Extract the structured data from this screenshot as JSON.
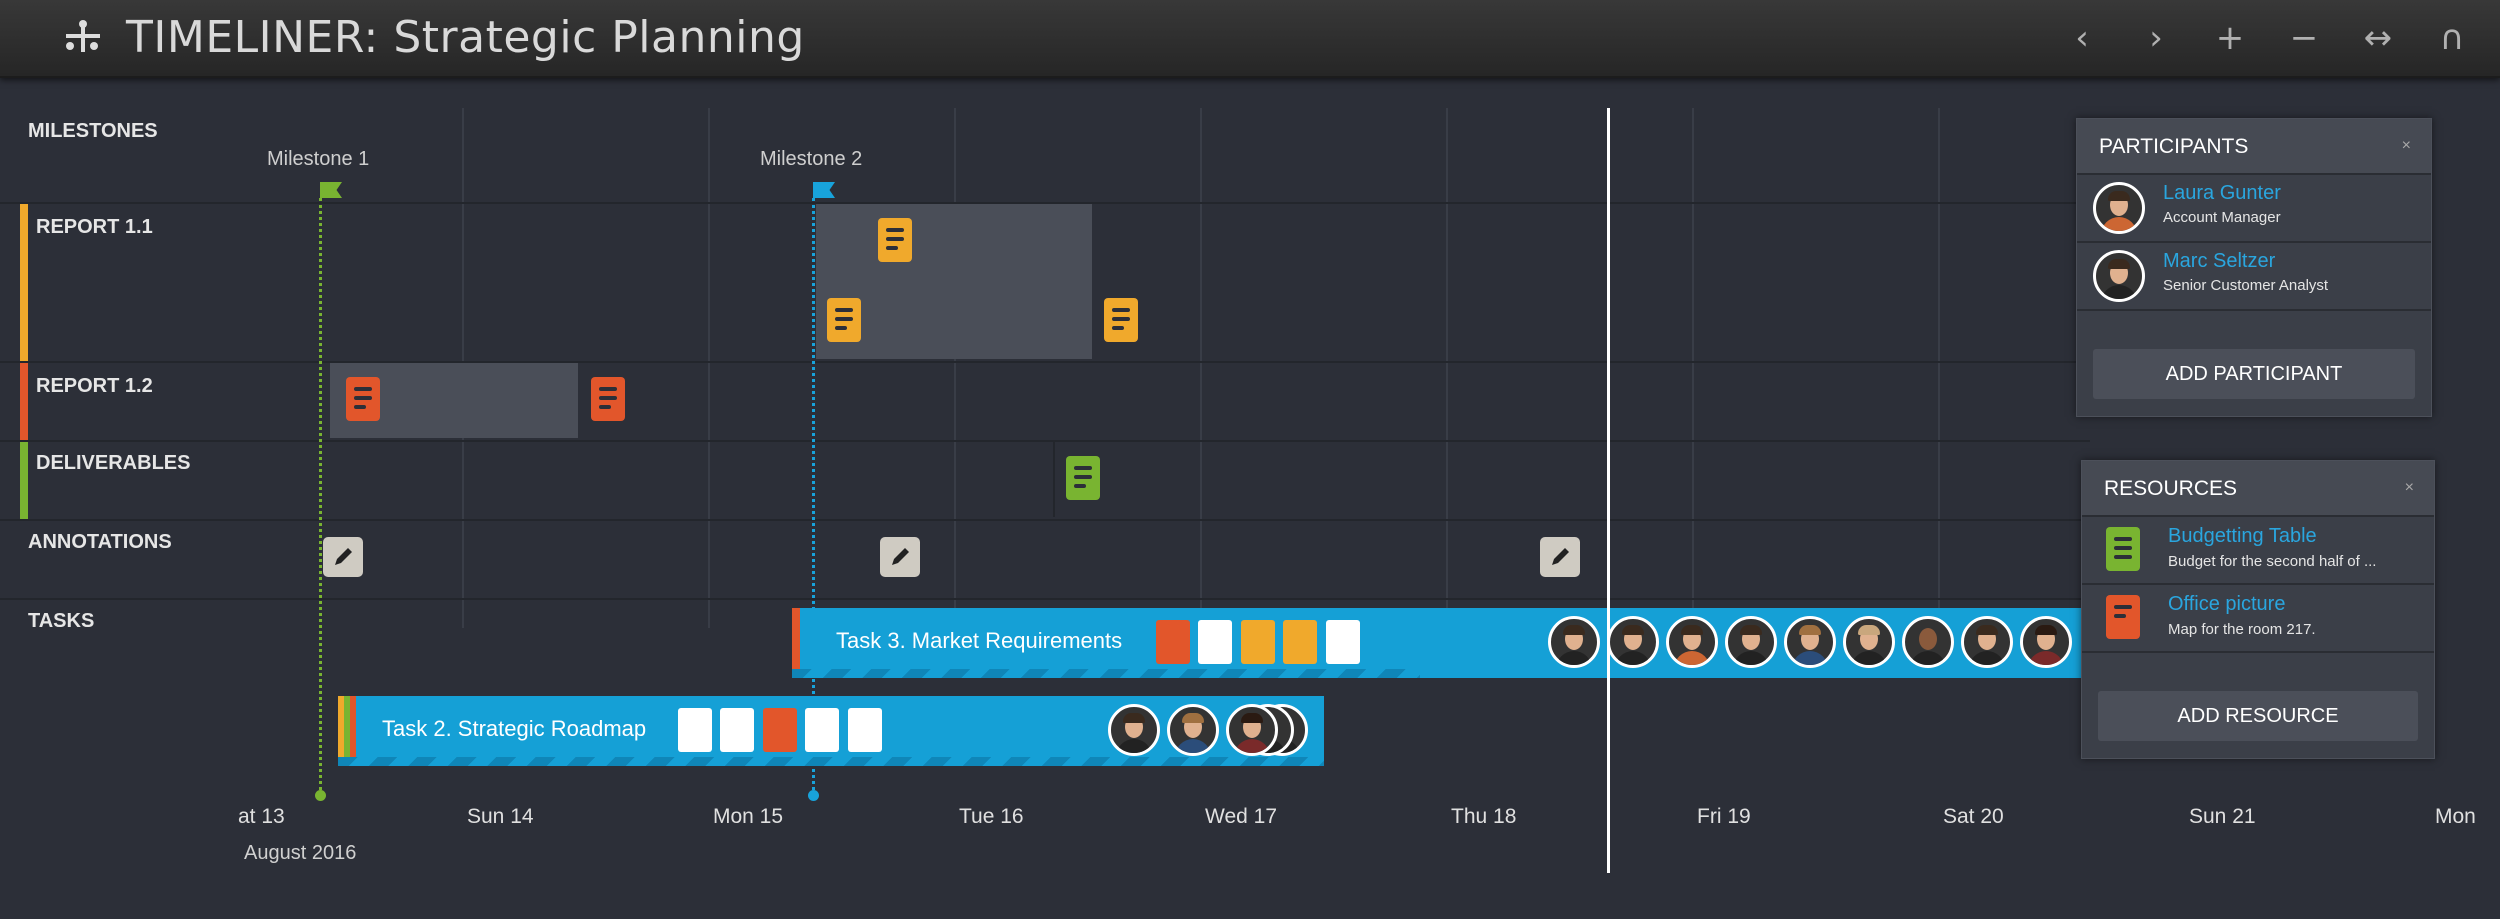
{
  "app": {
    "title": "TIMELINER: Strategic Planning"
  },
  "toolbar": {
    "prev": "‹",
    "next": "›",
    "zoom_in": "+",
    "zoom_out": "−",
    "fit": "↔",
    "magnet": "∩"
  },
  "rows": {
    "milestones": "MILESTONES",
    "report11": "REPORT 1.1",
    "report12": "REPORT 1.2",
    "deliverables": "DELIVERABLES",
    "annotations": "ANNOTATIONS",
    "tasks": "TASKS"
  },
  "row_colors": {
    "report11": "#f0a92c",
    "report12": "#e2562b",
    "deliverables": "#79b431"
  },
  "milestones": [
    {
      "label": "Milestone 1",
      "color": "#79b431"
    },
    {
      "label": "Milestone 2",
      "color": "#18a3db"
    }
  ],
  "tasks": [
    {
      "label": "Task 3. Market Requirements"
    },
    {
      "label": "Task 2. Strategic Roadmap"
    }
  ],
  "axis": {
    "ticks": [
      "at 13",
      "Sun 14",
      "Mon 15",
      "Tue 16",
      "Wed 17",
      "Thu 18",
      "Fri 19",
      "Sat 20",
      "Sun 21",
      "Mon"
    ],
    "month": "August 2016"
  },
  "participants": {
    "title": "PARTICIPANTS",
    "close": "×",
    "items": [
      {
        "name": "Laura Gunter",
        "role": "Account Manager"
      },
      {
        "name": "Marc Seltzer",
        "role": "Senior Customer Analyst"
      }
    ],
    "add_label": "ADD PARTICIPANT"
  },
  "resources": {
    "title": "RESOURCES",
    "close": "×",
    "items": [
      {
        "name": "Budgetting Table",
        "desc": "Budget for the second half of ...",
        "icon": "spreadsheet-icon",
        "color": "#79b431"
      },
      {
        "name": "Office picture",
        "desc": "Map for the room 217.",
        "icon": "image-file-icon",
        "color": "#e2562b"
      }
    ],
    "add_label": "ADD RESOURCE"
  }
}
